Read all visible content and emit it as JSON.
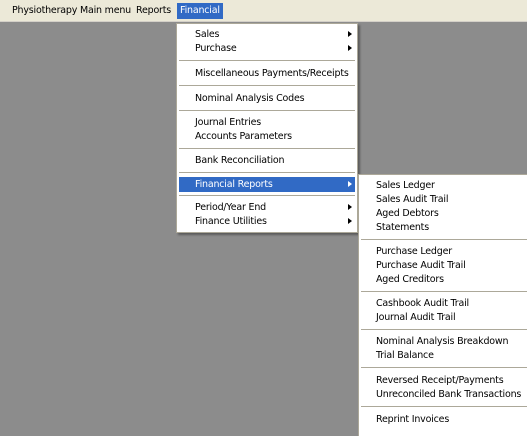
{
  "menubar": {
    "items": [
      "Physiotherapy Main menu",
      "Reports",
      "Financial"
    ]
  },
  "financial_menu": {
    "items": [
      "Sales",
      "Purchase",
      "Miscellaneous Payments/Receipts",
      "Nominal Analysis Codes",
      "Journal Entries",
      "Accounts Parameters",
      "Bank Reconciliation",
      "Financial Reports",
      "Period/Year End",
      "Finance Utilities"
    ]
  },
  "financial_reports_menu": {
    "items": [
      "Sales Ledger",
      "Sales Audit Trail",
      "Aged Debtors",
      "Statements",
      "Purchase Ledger",
      "Purchase Audit Trail",
      "Aged Creditors",
      "Cashbook Audit Trail",
      "Journal Audit Trail",
      "Nominal Analysis Breakdown",
      "Trial Balance",
      "Reversed Receipt/Payments",
      "Unreconciled Bank Transactions",
      "Reprint Invoices"
    ]
  },
  "colors": {
    "highlight": "#316ac5",
    "menubar": "#ece9d8",
    "workspace": "#8c8c8c"
  },
  "icons": [
    "submenu-arrow-icon"
  ]
}
